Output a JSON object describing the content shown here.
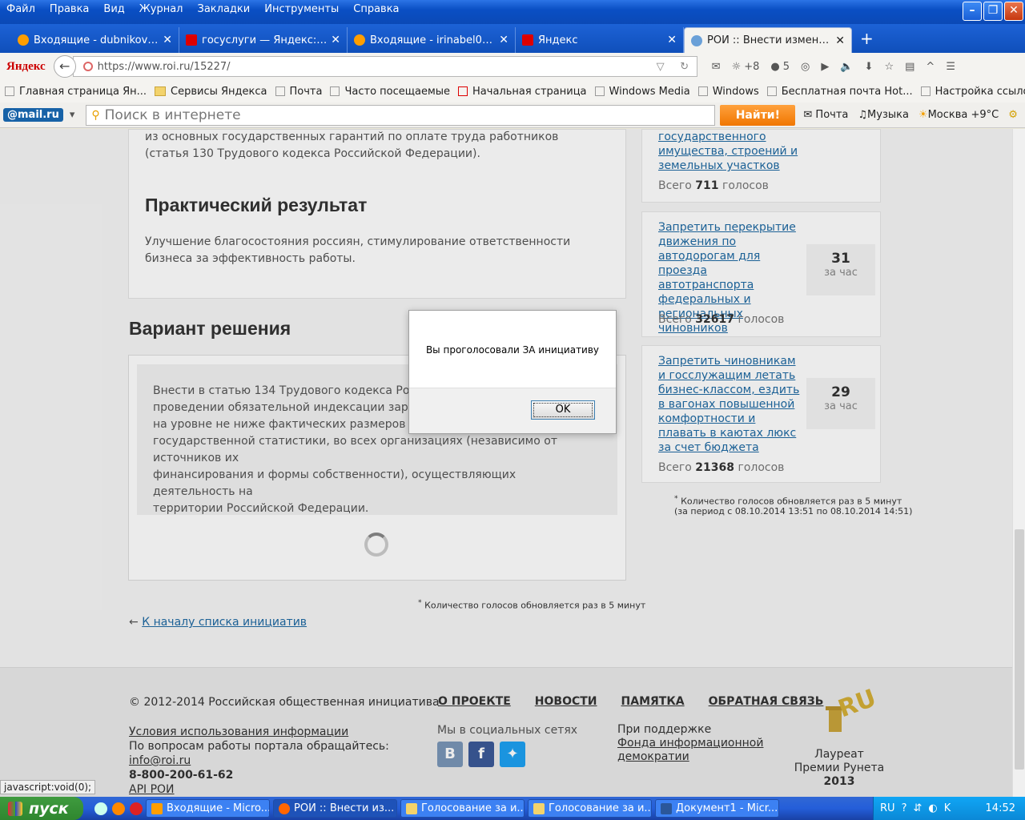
{
  "menu": [
    "Файл",
    "Правка",
    "Вид",
    "Журнал",
    "Закладки",
    "Инструменты",
    "Справка"
  ],
  "tabs": [
    {
      "label": "Входящие - dubnikovan...",
      "icon": "mailru-icon"
    },
    {
      "label": "госуслуги — Яндекс: на...",
      "icon": "yandex-icon"
    },
    {
      "label": "Входящие - irinabel010...",
      "icon": "mailru-icon"
    },
    {
      "label": "Яндекс",
      "icon": "yandex-icon"
    },
    {
      "label": "РОИ :: Внести изменен...",
      "icon": "roi-icon",
      "active": true
    }
  ],
  "nav": {
    "yandex_label": "Яндекс",
    "url_prefix": "https://",
    "url": "https://www.roi.ru/15227/",
    "weather": "+8",
    "badge_count": "5"
  },
  "bookmarks": [
    "Главная страница Ян...",
    "Сервисы Яндекса",
    "Почта",
    "Часто посещаемые",
    "Начальная страница",
    "Windows Media",
    "Windows",
    "Бесплатная почта Hot...",
    "Настройка ссылок"
  ],
  "mailbar": {
    "logo": "@mail.ru",
    "search_placeholder": "Поиск в интернете",
    "find_button": "Найти!",
    "mail": "Почта",
    "music": "Музыка",
    "weather": "Москва +9°С"
  },
  "page": {
    "p1": "из основных государственных гарантий по оплате труда работников (статья 130 Трудового кодекса Российской Федерации).",
    "h_result": "Практический результат",
    "p2": "Улучшение благосостояния россиян, стимулирование ответственности бизнеса за эффективность работы.",
    "h_variant": "Вариант решения",
    "variant_text": "Внести в статью 134 Трудового кодекса Российс... проведении обязательной индексации заработ... на уровне не ниже фактических размеров инфля... государственной статистики, во всех организациях (независимо от источников их финансирования и формы собственности), осуществляющих деятельность на территории Российской Федерации.",
    "variant_line1": "Внести в статью 134 Трудового кодекса Российс",
    "variant_line2": "проведении обязательной индексации заработ",
    "variant_line3": "на уровне не ниже фактических размеров инфля",
    "variant_line4": "государственной статистики, во всех организациях (независимо от источников их",
    "variant_line5": "финансирования и формы собственности), осуществляющих деятельность на",
    "variant_line6": "территории Российской Федерации.",
    "note": "Количество голосов обновляется раз в 5 минут",
    "back_arrow": "←",
    "back_link": "К началу списка инициатив"
  },
  "sidebar": {
    "items": [
      {
        "link": "государственного имущества, строений и земельных участков",
        "count": "",
        "per": "",
        "total_prefix": "Всего",
        "total": "711",
        "total_suffix": "голосов"
      },
      {
        "link": "Запретить перекрытие движения по автодорогам для проезда автотранспорта федеральных и региональных чиновников",
        "count": "31",
        "per": "за час",
        "total_prefix": "Всего",
        "total": "32617",
        "total_suffix": "голосов"
      },
      {
        "link": "Запретить чиновникам и госслужащим летать бизнес-классом, ездить в вагонах повышенной комфортности и плавать в каютах люкс за счет бюджета",
        "count": "29",
        "per": "за час",
        "total_prefix": "Всего",
        "total": "21368",
        "total_suffix": "голосов"
      }
    ],
    "note_line1": "Количество голосов обновляется раз в 5 минут",
    "note_line2": "(за период с 08.10.2014 13:51 по 08.10.2014 14:51)"
  },
  "footer": {
    "copyright": "© 2012-2014 Российская общественная инициатива",
    "nav": [
      "О ПРОЕКТЕ",
      "НОВОСТИ",
      "ПАМЯТКА",
      "ОБРАТНАЯ СВЯЗЬ"
    ],
    "terms": "Условия использования информации",
    "contact": "По вопросам работы портала обращайтесь:",
    "email": "info@roi.ru",
    "phone": "8-800-200-61-62",
    "api": "API РОИ",
    "social_label": "Мы в социальных сетях",
    "support_label": "При поддержке",
    "support_link1": "Фонда информационной",
    "support_link2": "демократии",
    "laureate1": "Лауреат",
    "laureate2": "Премии Рунета",
    "laureate3": "2013",
    "ru_badge": "RU"
  },
  "status_url": "javascript:void(0);",
  "dialog": {
    "message": "Вы проголосовали ЗА инициативу",
    "ok": "OK"
  },
  "taskbar": {
    "start": "пуск",
    "tasks": [
      "Входящие - Micro...",
      "РОИ :: Внести из...",
      "Голосование за и...",
      "Голосование за и...",
      "Документ1 - Micr..."
    ],
    "lang": "RU",
    "clock": "14:52"
  },
  "colors": {
    "link": "#1f6aa3",
    "accent_orange": "#f07600",
    "taskbar_blue": "#245ed9"
  }
}
